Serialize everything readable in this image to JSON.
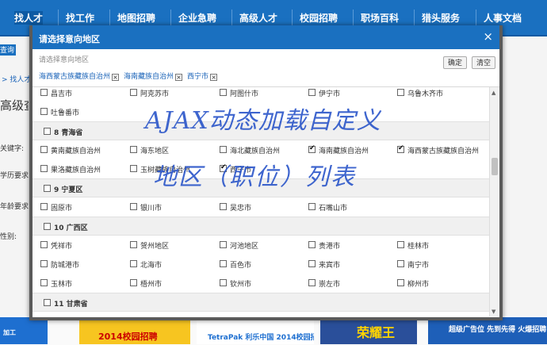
{
  "topnav": {
    "items": [
      "找人才",
      "找工作",
      "地图招聘",
      "企业急聘",
      "高级人才",
      "校园招聘",
      "职场百科",
      "猎头服务",
      "人事文档"
    ]
  },
  "background": {
    "left_button": "查询",
    "breadcrumb": "> 找人才",
    "heading": "高级查",
    "fields": [
      "关键字:",
      "学历要求:",
      "年龄要求:",
      "性别:"
    ],
    "banners": [
      "加工",
      "2014校园招聘",
      "TetraPak 利乐中国 2014校园招聘",
      "荣耀王",
      "超级广告位 先到先得 火爆招聘"
    ]
  },
  "dialog": {
    "title": "请选择意向地区",
    "close_symbol": "×",
    "subtitle": "请选择意向地区",
    "confirm_label": "确定",
    "clear_label": "清空",
    "selected_tags": [
      "海西蒙古族藏族自治州",
      "海南藏族自治州",
      "西宁市"
    ],
    "tag_remove_symbol": "×",
    "rows": [
      {
        "type": "items",
        "items": [
          {
            "label": "昌吉市",
            "checked": false
          },
          {
            "label": "阿克苏市",
            "checked": false
          },
          {
            "label": "阿图什市",
            "checked": false
          },
          {
            "label": "伊宁市",
            "checked": false
          },
          {
            "label": "乌鲁木齐市",
            "checked": false
          }
        ]
      },
      {
        "type": "items",
        "items": [
          {
            "label": "吐鲁番市",
            "checked": false
          }
        ]
      },
      {
        "type": "header",
        "label": "8 青海省"
      },
      {
        "type": "items",
        "items": [
          {
            "label": "黄南藏族自治州",
            "checked": false
          },
          {
            "label": "海东地区",
            "checked": false
          },
          {
            "label": "海北藏族自治州",
            "checked": false
          },
          {
            "label": "海南藏族自治州",
            "checked": true
          },
          {
            "label": "海西蒙古族藏族自治州",
            "checked": true
          }
        ]
      },
      {
        "type": "items",
        "items": [
          {
            "label": "果洛藏族自治州",
            "checked": false
          },
          {
            "label": "玉树藏族自治州",
            "checked": false
          },
          {
            "label": "西宁市",
            "checked": true
          }
        ]
      },
      {
        "type": "header",
        "label": "9 宁夏区"
      },
      {
        "type": "items",
        "items": [
          {
            "label": "固原市",
            "checked": false
          },
          {
            "label": "银川市",
            "checked": false
          },
          {
            "label": "吴忠市",
            "checked": false
          },
          {
            "label": "石嘴山市",
            "checked": false
          }
        ]
      },
      {
        "type": "header",
        "label": "10 广西区"
      },
      {
        "type": "items",
        "items": [
          {
            "label": "凭祥市",
            "checked": false
          },
          {
            "label": "贺州地区",
            "checked": false
          },
          {
            "label": "河池地区",
            "checked": false
          },
          {
            "label": "贵港市",
            "checked": false
          },
          {
            "label": "桂林市",
            "checked": false
          }
        ]
      },
      {
        "type": "items",
        "items": [
          {
            "label": "防城港市",
            "checked": false
          },
          {
            "label": "北海市",
            "checked": false
          },
          {
            "label": "百色市",
            "checked": false
          },
          {
            "label": "来宾市",
            "checked": false
          },
          {
            "label": "南宁市",
            "checked": false
          }
        ]
      },
      {
        "type": "items",
        "items": [
          {
            "label": "玉林市",
            "checked": false
          },
          {
            "label": "梧州市",
            "checked": false
          },
          {
            "label": "钦州市",
            "checked": false
          },
          {
            "label": "崇左市",
            "checked": false
          },
          {
            "label": "柳州市",
            "checked": false
          }
        ]
      },
      {
        "type": "header",
        "label": "11 甘肃省"
      }
    ]
  },
  "overlay": {
    "line1": "AJAX动态加载自定义",
    "line2": "地区（职位）列表"
  }
}
